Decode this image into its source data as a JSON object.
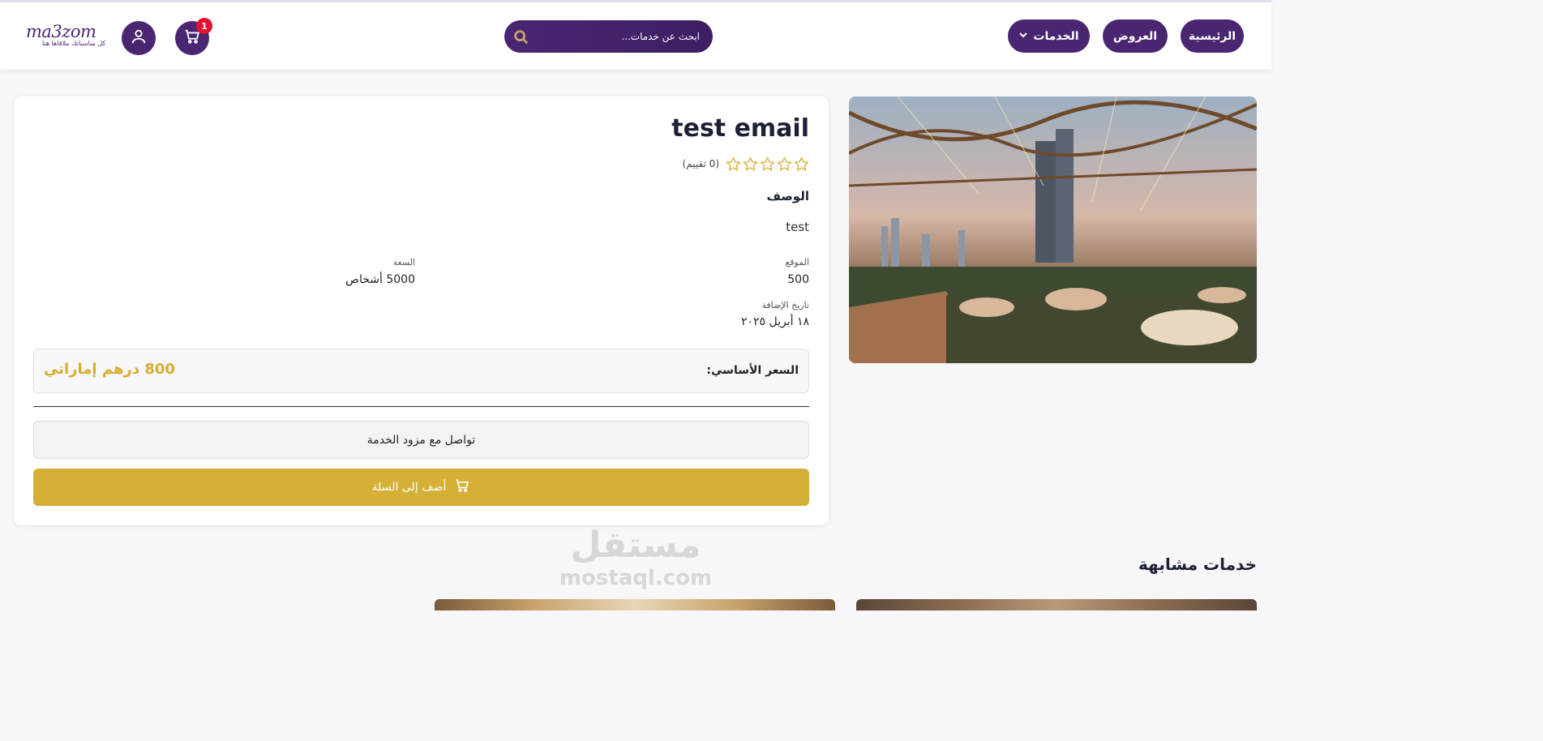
{
  "header": {
    "logo": {
      "name": "ma3zom",
      "tagline": "كل مناسباتك ملاقاها هنا"
    },
    "cart_count": "1",
    "search": {
      "placeholder": "ابحث عن خدمات..."
    },
    "nav": {
      "home": "الرئيسية",
      "offers": "العروض",
      "services": "الخدمات"
    }
  },
  "product": {
    "title": "test email",
    "rating_text": "(0 تقييم)",
    "stars_total": 5,
    "stars_filled": 0,
    "description_heading": "الوصف",
    "description": "test",
    "location_label": "الموقع",
    "location_value": "500",
    "capacity_label": "السعة",
    "capacity_value": "5000 أشخاص",
    "date_label": "تاريخ الإضافة",
    "date_value": "١٨ أبريل ٢٠٢٥",
    "price_label": "السعر الأساسي:",
    "price_value": "800 درهم إماراتي",
    "contact_button": "تواصل مع مزود الخدمة",
    "add_to_cart_button": "أضف إلى السلة"
  },
  "similar": {
    "heading": "خدمات مشابهة"
  },
  "watermark": {
    "arabic": "مستقل",
    "latin": "mostaql.com"
  },
  "colors": {
    "primary": "#4a2672",
    "accent": "#d5af36",
    "badge": "#e3122f"
  },
  "icons": [
    "cart-icon",
    "user-icon",
    "search-icon",
    "chevron-down-icon",
    "star-icon"
  ]
}
